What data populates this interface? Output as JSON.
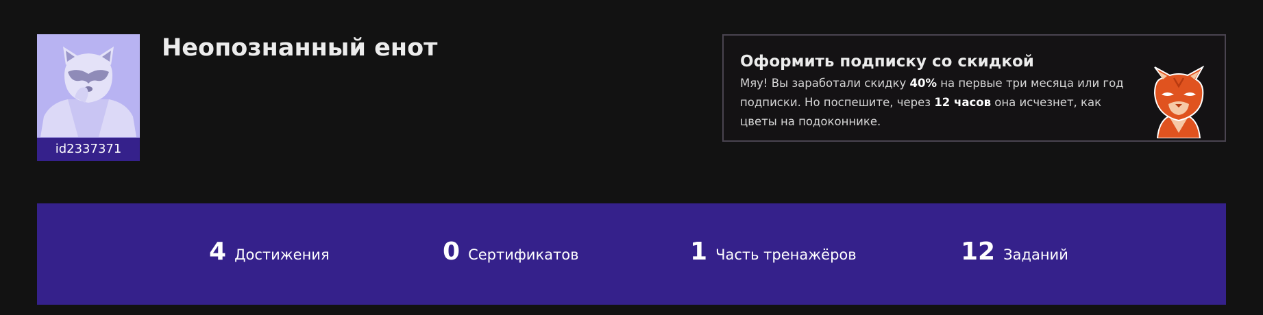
{
  "profile": {
    "id_label": "id2337371",
    "username": "Неопознанный енот",
    "avatar_icon": "raccoon-avatar-icon"
  },
  "promo": {
    "title": "Оформить подписку со скидкой",
    "text_part1": "Мяу! Вы заработали скидку ",
    "discount": "40%",
    "text_part2": " на первые три месяца или год подписки. Но поспешите, через ",
    "time": "12 часов",
    "text_part3": " она исчезнет, как цветы на подоконнике.",
    "mascot_icon": "cat-mascot-icon"
  },
  "stats": [
    {
      "value": "4",
      "label": "Достижения"
    },
    {
      "value": "0",
      "label": "Сертификатов"
    },
    {
      "value": "1",
      "label": "Часть тренажёров"
    },
    {
      "value": "12",
      "label": "Заданий"
    }
  ],
  "colors": {
    "background": "#121212",
    "accent": "#35218b",
    "avatar_bg": "#b8b3f2",
    "promo_border": "#4a4450",
    "mascot_orange": "#e0531f"
  }
}
